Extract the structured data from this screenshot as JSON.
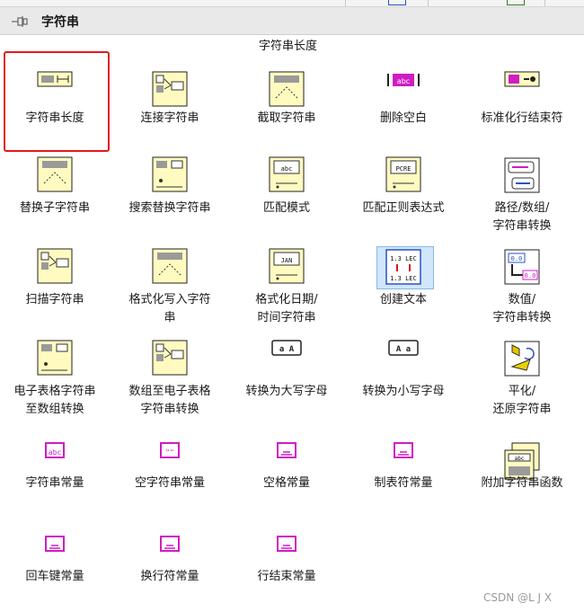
{
  "palette": {
    "title": "字符串",
    "tooltip": "字符串长度"
  },
  "items": [
    {
      "label": "字符串长度",
      "icon": "string-length-icon"
    },
    {
      "label": "连接字符串",
      "icon": "concatenate-strings-icon"
    },
    {
      "label": "截取字符串",
      "icon": "string-subset-icon"
    },
    {
      "label": "删除空白",
      "icon": "trim-whitespace-icon"
    },
    {
      "label": "标准化行结束符",
      "icon": "normalize-eol-icon"
    },
    {
      "label": "替换子字符串",
      "icon": "replace-substring-icon"
    },
    {
      "label": "搜索替换字符串",
      "icon": "search-replace-icon"
    },
    {
      "label": "匹配模式",
      "icon": "match-pattern-icon",
      "glyph": "abc"
    },
    {
      "label": "匹配正则表达式",
      "icon": "match-regex-icon",
      "glyph": "PCRE"
    },
    {
      "label": "路径/数组/\n字符串转换",
      "icon": "path-array-string-icon"
    },
    {
      "label": "扫描字符串",
      "icon": "scan-string-icon"
    },
    {
      "label": "格式化写入字符\n串",
      "icon": "format-into-string-icon"
    },
    {
      "label": "格式化日期/\n时间字符串",
      "icon": "format-date-time-icon",
      "glyph": "JAN"
    },
    {
      "label": "创建文本",
      "icon": "build-text-icon",
      "glyph": "1.3 LEC"
    },
    {
      "label": "数值/\n字符串转换",
      "icon": "number-string-icon",
      "glyph": "0.0"
    },
    {
      "label": "电子表格字符串\n至数组转换",
      "icon": "spreadsheet-to-array-icon"
    },
    {
      "label": "数组至电子表格\n字符串转换",
      "icon": "array-to-spreadsheet-icon"
    },
    {
      "label": "转换为大写字母",
      "icon": "to-upper-case-icon",
      "glyph": "a A"
    },
    {
      "label": "转换为小写字母",
      "icon": "to-lower-case-icon",
      "glyph": "A a"
    },
    {
      "label": "平化/\n还原字符串",
      "icon": "flatten-unflatten-icon"
    },
    {
      "label": "字符串常量",
      "icon": "string-constant-icon",
      "glyph": "abc"
    },
    {
      "label": "空字符串常量",
      "icon": "empty-string-icon",
      "glyph": "\"\""
    },
    {
      "label": "空格常量",
      "icon": "space-constant-icon"
    },
    {
      "label": "制表符常量",
      "icon": "tab-constant-icon"
    },
    {
      "label": "附加字符串函数",
      "icon": "additional-string-functions-icon",
      "glyph": "abc"
    },
    {
      "label": "回车键常量",
      "icon": "carriage-return-icon"
    },
    {
      "label": "换行符常量",
      "icon": "line-feed-icon"
    },
    {
      "label": "行结束常量",
      "icon": "end-of-line-icon"
    }
  ],
  "watermark": "CSDN @L J X",
  "colors": {
    "selection": "#e21b1b",
    "constant_magenta": "#d01cc4",
    "vi_yellow": "#fffbc0"
  }
}
